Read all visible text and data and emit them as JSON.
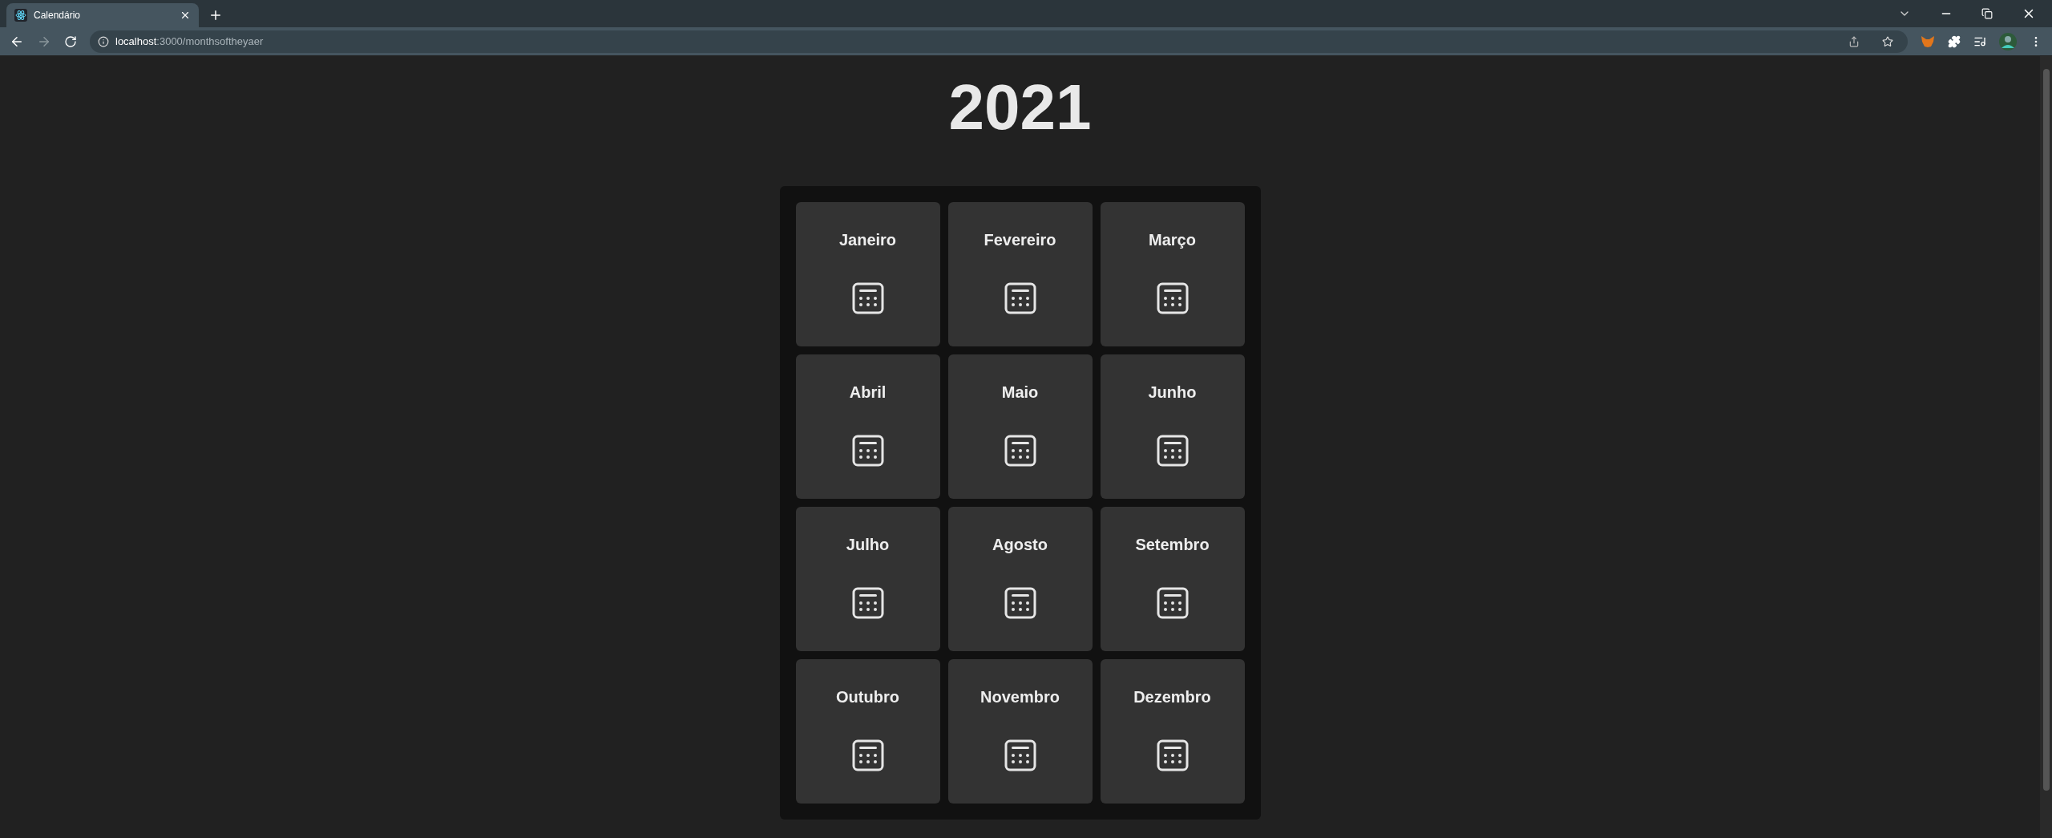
{
  "browser": {
    "tab": {
      "title": "Calendário"
    },
    "url": {
      "host": "localhost",
      "path": ":3000/monthsoftheyaer"
    }
  },
  "year": "2021",
  "months": [
    {
      "name": "Janeiro"
    },
    {
      "name": "Fevereiro"
    },
    {
      "name": "Março"
    },
    {
      "name": "Abril"
    },
    {
      "name": "Maio"
    },
    {
      "name": "Junho"
    },
    {
      "name": "Julho"
    },
    {
      "name": "Agosto"
    },
    {
      "name": "Setembro"
    },
    {
      "name": "Outubro"
    },
    {
      "name": "Novembro"
    },
    {
      "name": "Dezembro"
    }
  ]
}
